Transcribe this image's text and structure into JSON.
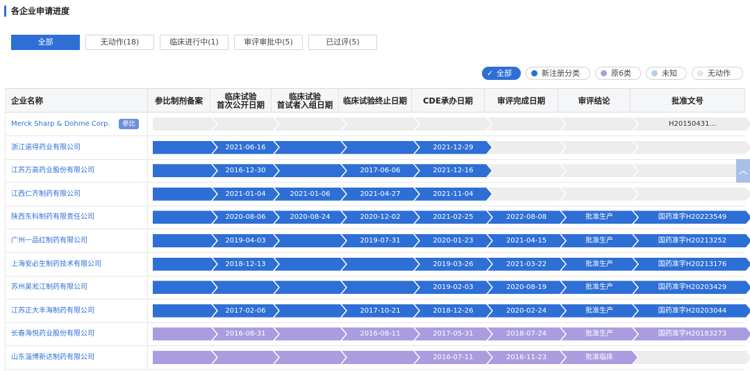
{
  "title": "各企业申请进度",
  "filters": [
    {
      "label": "全部",
      "active": true
    },
    {
      "label": "无动作(18)",
      "active": false
    },
    {
      "label": "临床进行中(1)",
      "active": false
    },
    {
      "label": "审评审批中(5)",
      "active": false
    },
    {
      "label": "已过评(5)",
      "active": false
    }
  ],
  "legend": [
    {
      "label": "全部",
      "active": true,
      "color": "#2e6fd6",
      "check": "✓"
    },
    {
      "label": "新注册分类",
      "active": false,
      "color": "#2e6fd6"
    },
    {
      "label": "原6类",
      "active": false,
      "color": "#ab9ce0"
    },
    {
      "label": "未知",
      "active": false,
      "color": "#b7cdf0"
    },
    {
      "label": "无动作",
      "active": false,
      "color": "#e6e6e6"
    }
  ],
  "columns": [
    {
      "label": "企业名称"
    },
    {
      "label": "参比制剂备案"
    },
    {
      "label": "临床试验",
      "label2": "首次公开日期"
    },
    {
      "label": "临床试验",
      "label2": "首试者入组日期"
    },
    {
      "label": "临床试验终止日期"
    },
    {
      "label": "CDE承办日期"
    },
    {
      "label": "审评完成日期"
    },
    {
      "label": "审评结论"
    },
    {
      "label": "批准文号"
    }
  ],
  "rows": [
    {
      "company": "Merck Sharp & Dohme Corp.",
      "badge": "参比",
      "type": "empty",
      "stages": [
        "",
        "",
        "",
        "",
        "",
        "",
        "",
        "H20150431..."
      ]
    },
    {
      "company": "浙江诺得药业有限公司",
      "type": "blue",
      "filled": 5,
      "stages": [
        "",
        "2021-06-16",
        "",
        "",
        "2021-12-29",
        "",
        "",
        ""
      ]
    },
    {
      "company": "江苏万高药业股份有限公司",
      "type": "blue",
      "filled": 5,
      "stages": [
        "",
        "2016-12-30",
        "",
        "2017-06-06",
        "2021-12-16",
        "",
        "",
        ""
      ]
    },
    {
      "company": "江西仁齐制药有限公司",
      "type": "blue",
      "filled": 5,
      "stages": [
        "",
        "2021-01-04",
        "2021-01-06",
        "2021-04-27",
        "2021-11-04",
        "",
        "",
        ""
      ]
    },
    {
      "company": "陕西东科制药有限责任公司",
      "type": "blue",
      "filled": 8,
      "stages": [
        "",
        "2020-08-06",
        "2020-08-24",
        "2020-12-02",
        "2021-02-25",
        "2022-08-08",
        "批准生产",
        "国药准字H20223549"
      ]
    },
    {
      "company": "广州一品红制药有限公司",
      "type": "blue",
      "filled": 8,
      "stages": [
        "",
        "2019-04-03",
        "",
        "2019-07-31",
        "2020-01-23",
        "2021-04-15",
        "批准生产",
        "国药准字H20213252"
      ]
    },
    {
      "company": "上海安必生制药技术有限公司",
      "type": "blue",
      "filled": 8,
      "stages": [
        "",
        "2018-12-13",
        "",
        "",
        "2019-03-26",
        "2021-03-22",
        "批准生产",
        "国药准字H20213176"
      ]
    },
    {
      "company": "苏州昊淞江制药有限公司",
      "type": "blue",
      "filled": 8,
      "stages": [
        "",
        "",
        "",
        "",
        "2019-02-03",
        "2020-08-19",
        "批准生产",
        "国药准字H20203429"
      ]
    },
    {
      "company": "江苏正大丰海制药有限公司",
      "type": "blue",
      "filled": 8,
      "stages": [
        "",
        "2017-02-06",
        "",
        "2017-10-21",
        "2018-12-26",
        "2020-02-24",
        "批准生产",
        "国药准字H20203044"
      ]
    },
    {
      "company": "长春海悦药业股份有限公司",
      "type": "purple",
      "filled": 8,
      "stages": [
        "",
        "2016-08-31",
        "",
        "2016-08-11",
        "2017-05-31",
        "2018-07-24",
        "批准生产",
        "国药准字H20183273"
      ]
    },
    {
      "company": "山东淄博新达制药有限公司",
      "type": "purple",
      "filled": 7,
      "stages": [
        "",
        "",
        "",
        "",
        "2016-07-11",
        "2016-11-23",
        "批准临床",
        ""
      ]
    }
  ]
}
